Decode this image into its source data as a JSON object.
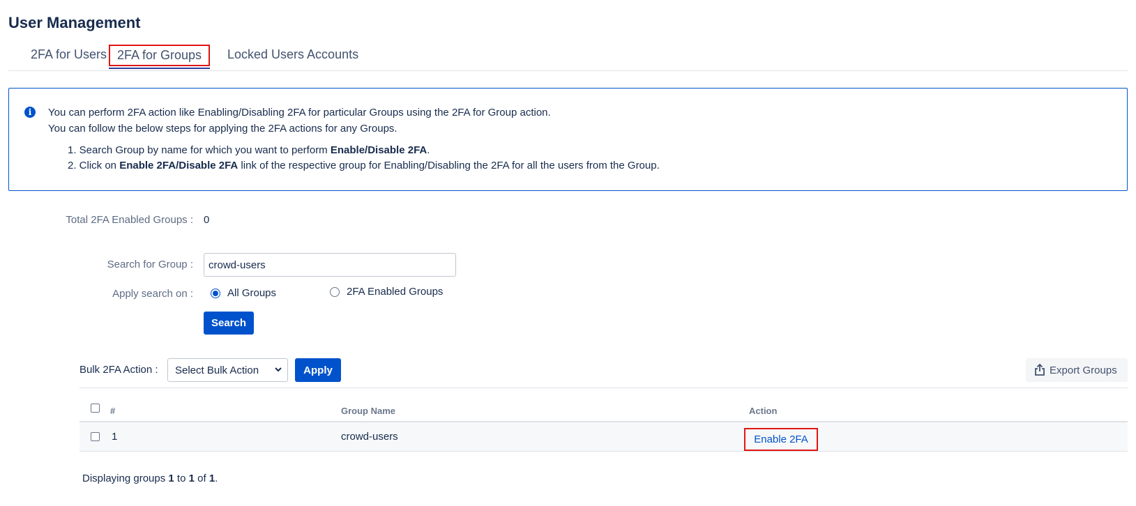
{
  "page": {
    "title": "User Management"
  },
  "tabs": [
    {
      "label": "2FA for Users"
    },
    {
      "label": "2FA for Groups"
    },
    {
      "label": "Locked Users Accounts"
    }
  ],
  "info": {
    "line1": "You can perform 2FA action like Enabling/Disabling 2FA for particular Groups using the 2FA for Group action.",
    "line2": "You can follow the below steps for applying the 2FA actions for any Groups.",
    "step1_prefix": "1. Search Group by name for which you want to perform ",
    "step1_bold": "Enable/Disable 2FA",
    "step1_suffix": ".",
    "step2_prefix": "2. Click on ",
    "step2_bold": "Enable 2FA/Disable 2FA",
    "step2_suffix": " link of the respective group for Enabling/Disabling the 2FA for all the users from the Group."
  },
  "stats": {
    "total_label": "Total 2FA Enabled Groups :",
    "total_value": "0"
  },
  "search": {
    "label": "Search for Group :",
    "value": "crowd-users",
    "apply_label": "Apply search on :",
    "options": [
      "All Groups",
      "2FA Enabled Groups"
    ],
    "selected": "All Groups",
    "button": "Search"
  },
  "bulk": {
    "label": "Bulk 2FA Action :",
    "select_value": "Select Bulk Action",
    "apply": "Apply"
  },
  "export": {
    "label": "Export Groups"
  },
  "table": {
    "headers": [
      "#",
      "Group Name",
      "Action"
    ],
    "rows": [
      {
        "index": "1",
        "group": "crowd-users",
        "action": "Enable 2FA"
      }
    ]
  },
  "footer": {
    "prefix": "Displaying groups ",
    "from": "1",
    "to_word": " to ",
    "to": "1",
    "of_word": " of ",
    "total": "1",
    "suffix": "."
  },
  "colors": {
    "primary": "#0052cc",
    "highlight": "#e01515"
  }
}
